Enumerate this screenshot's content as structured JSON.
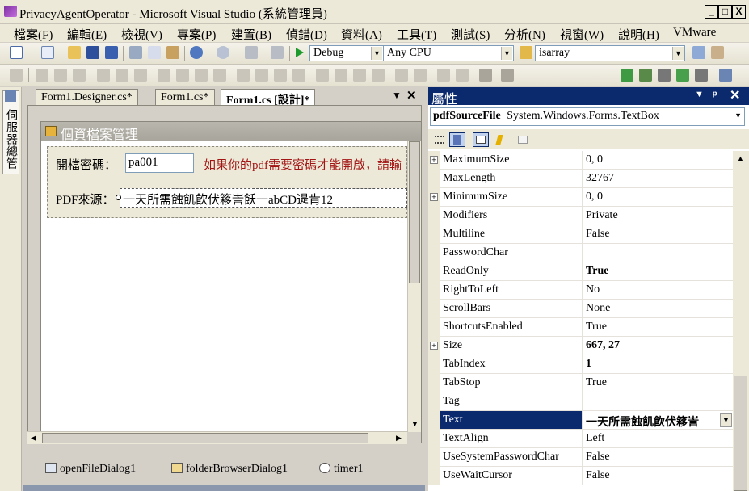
{
  "window": {
    "title": "PrivacyAgentOperator - Microsoft Visual Studio (系統管理員)",
    "min": "_",
    "max": "□",
    "close": "X"
  },
  "menu": [
    "檔案(F)",
    "編輯(E)",
    "檢視(V)",
    "專案(P)",
    "建置(B)",
    "偵錯(D)",
    "資料(A)",
    "工具(T)",
    "測試(S)",
    "分析(N)",
    "視窗(W)",
    "說明(H)",
    "VMware"
  ],
  "toolbar": {
    "config": "Debug",
    "platform": "Any CPU",
    "find": "isarray"
  },
  "toolbox": {
    "label": "伺服器總管"
  },
  "doc_tabs": [
    "Form1.Designer.cs*",
    "Form1.cs*",
    "Form1.cs [設計]*"
  ],
  "form": {
    "title": "個資檔案管理",
    "password_label": "開檔密碼：",
    "password_value": "pa001",
    "hint": "如果你的pdf需要密碼才能開啟，請輸",
    "source_label": "PDF來源：",
    "source_value": "一天所需蝕飢飮伏簃訔飫一abCD遈肯12"
  },
  "tray": [
    "openFileDialog1",
    "folderBrowserDialog1",
    "timer1"
  ],
  "properties": {
    "header": "屬性",
    "object_name": "pdfSourceFile",
    "object_type": "System.Windows.Forms.TextBox",
    "rows": [
      {
        "name": "MaximumSize",
        "value": "0, 0",
        "expand": true
      },
      {
        "name": "MaxLength",
        "value": "32767"
      },
      {
        "name": "MinimumSize",
        "value": "0, 0",
        "expand": true
      },
      {
        "name": "Modifiers",
        "value": "Private"
      },
      {
        "name": "Multiline",
        "value": "False"
      },
      {
        "name": "PasswordChar",
        "value": ""
      },
      {
        "name": "ReadOnly",
        "value": "True",
        "bold": true
      },
      {
        "name": "RightToLeft",
        "value": "No"
      },
      {
        "name": "ScrollBars",
        "value": "None"
      },
      {
        "name": "ShortcutsEnabled",
        "value": "True"
      },
      {
        "name": "Size",
        "value": "667, 27",
        "expand": true,
        "bold": true
      },
      {
        "name": "TabIndex",
        "value": "1",
        "bold": true
      },
      {
        "name": "TabStop",
        "value": "True"
      },
      {
        "name": "Tag",
        "value": ""
      },
      {
        "name": "Text",
        "value": "一天所需蝕飢飮伏簃訔",
        "selected": true,
        "bold": true
      },
      {
        "name": "TextAlign",
        "value": "Left"
      },
      {
        "name": "UseSystemPasswordChar",
        "value": "False"
      },
      {
        "name": "UseWaitCursor",
        "value": "False"
      }
    ]
  }
}
